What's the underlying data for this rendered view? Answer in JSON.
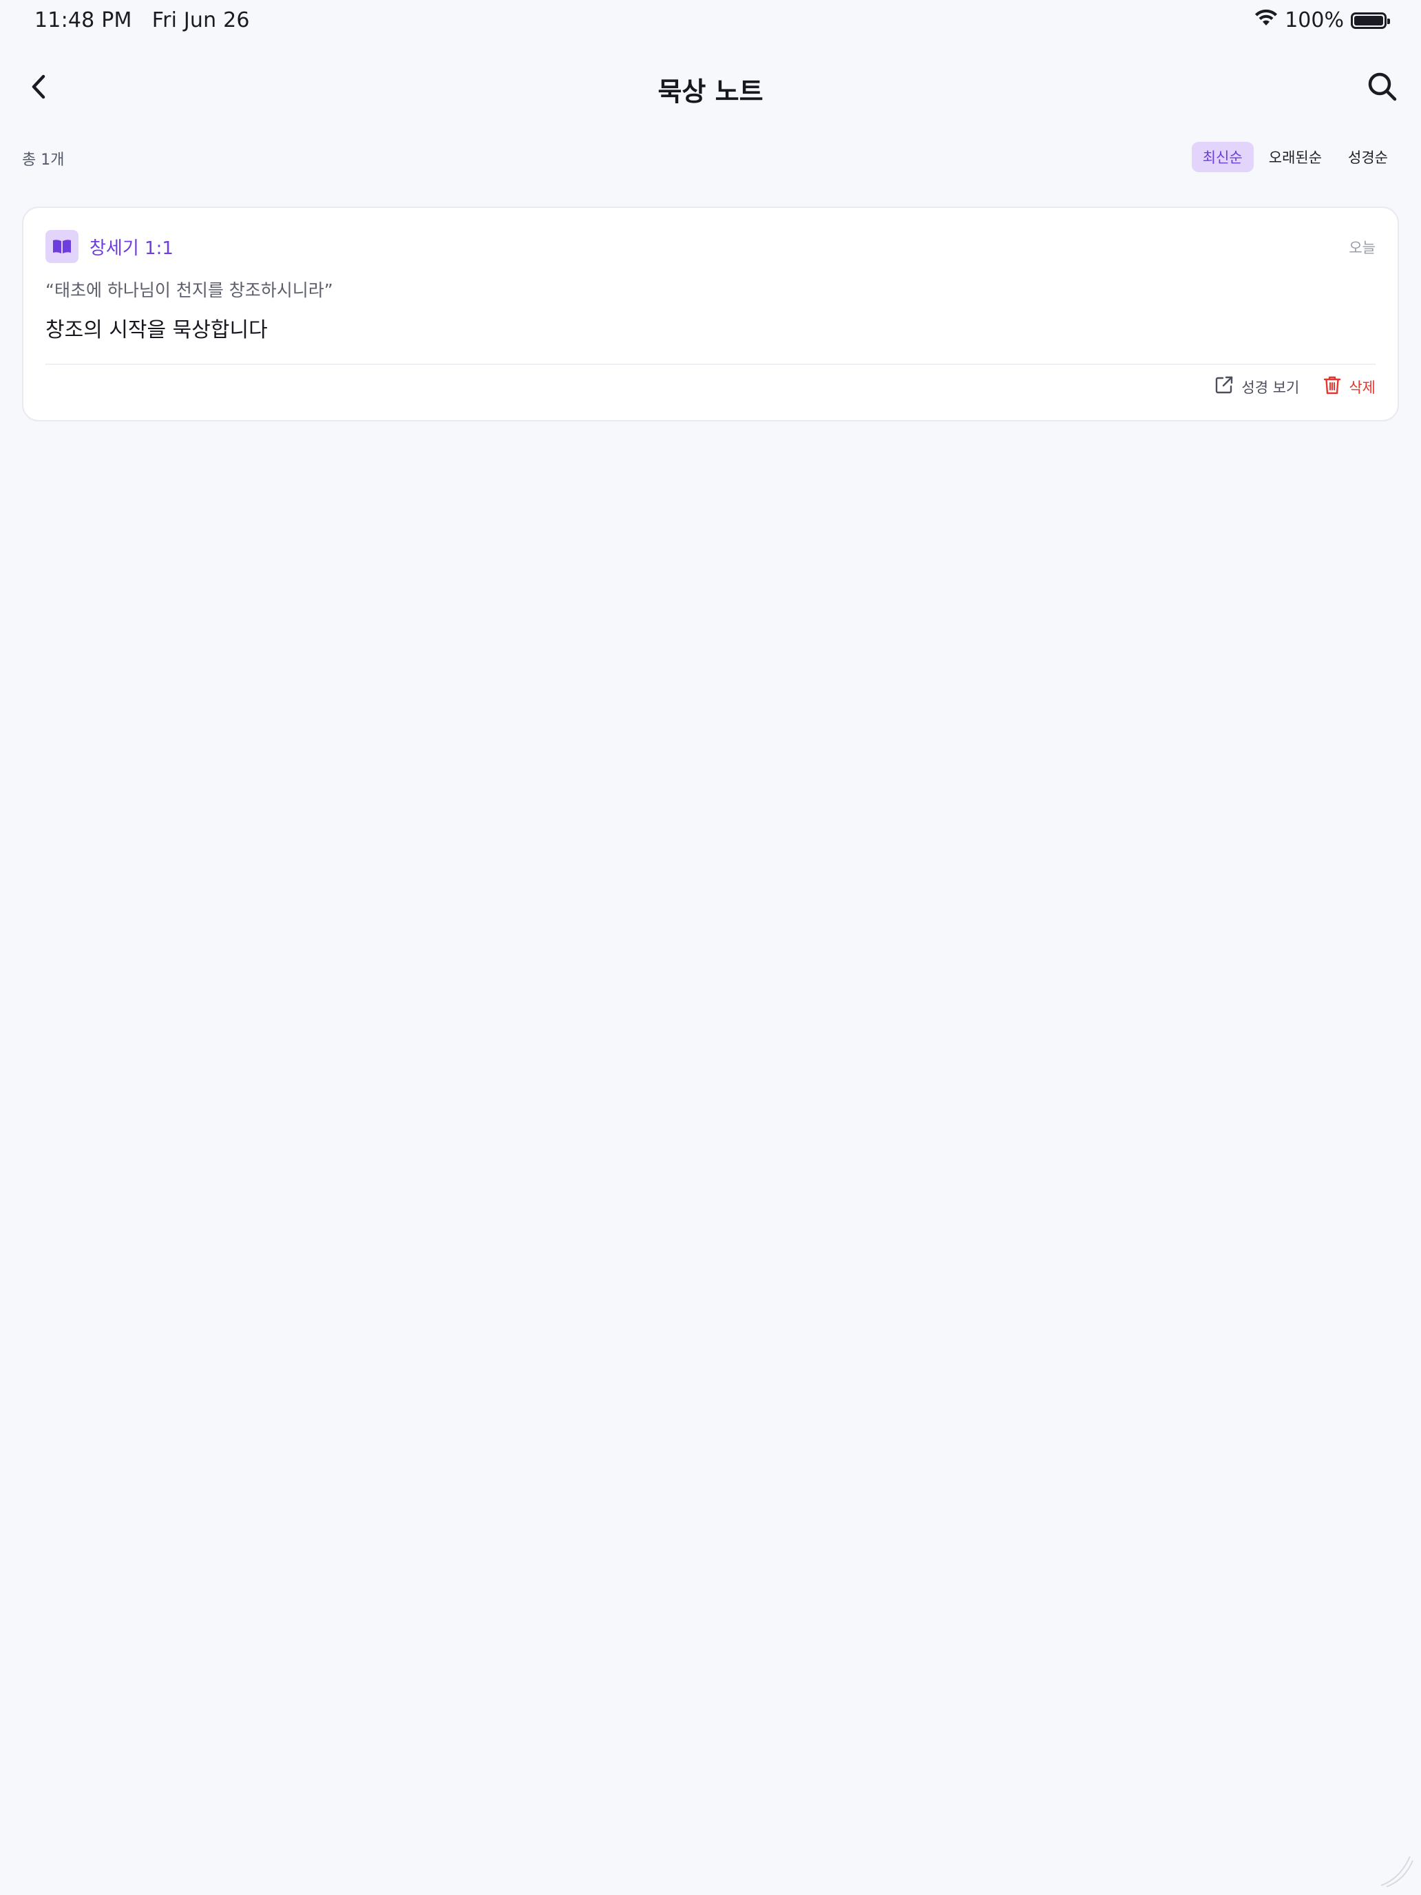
{
  "status_bar": {
    "time": "11:48 PM",
    "date": "Fri Jun 26",
    "battery": "100%",
    "battery_level": 1.0
  },
  "header": {
    "title": "묵상 노트",
    "back_icon": "chevron-left-icon",
    "search_icon": "search-icon"
  },
  "toolbar": {
    "total": "총 1개",
    "sort_options": [
      {
        "label": "최신순",
        "active": true
      },
      {
        "label": "오래된순",
        "active": false
      },
      {
        "label": "성경순",
        "active": false
      }
    ]
  },
  "notes": [
    {
      "reference": "창세기 1:1",
      "date": "오늘",
      "quote": "“태초에 하나님이 천지를 창조하시니라”",
      "body": "창조의 시작을 묵상합니다",
      "actions": {
        "view": "성경 보기",
        "delete": "삭제"
      }
    }
  ],
  "colors": {
    "accent": "#6d3de0",
    "accent_bg": "#e3d4fb",
    "danger": "#e5352f",
    "background": "#f7f8fc"
  }
}
